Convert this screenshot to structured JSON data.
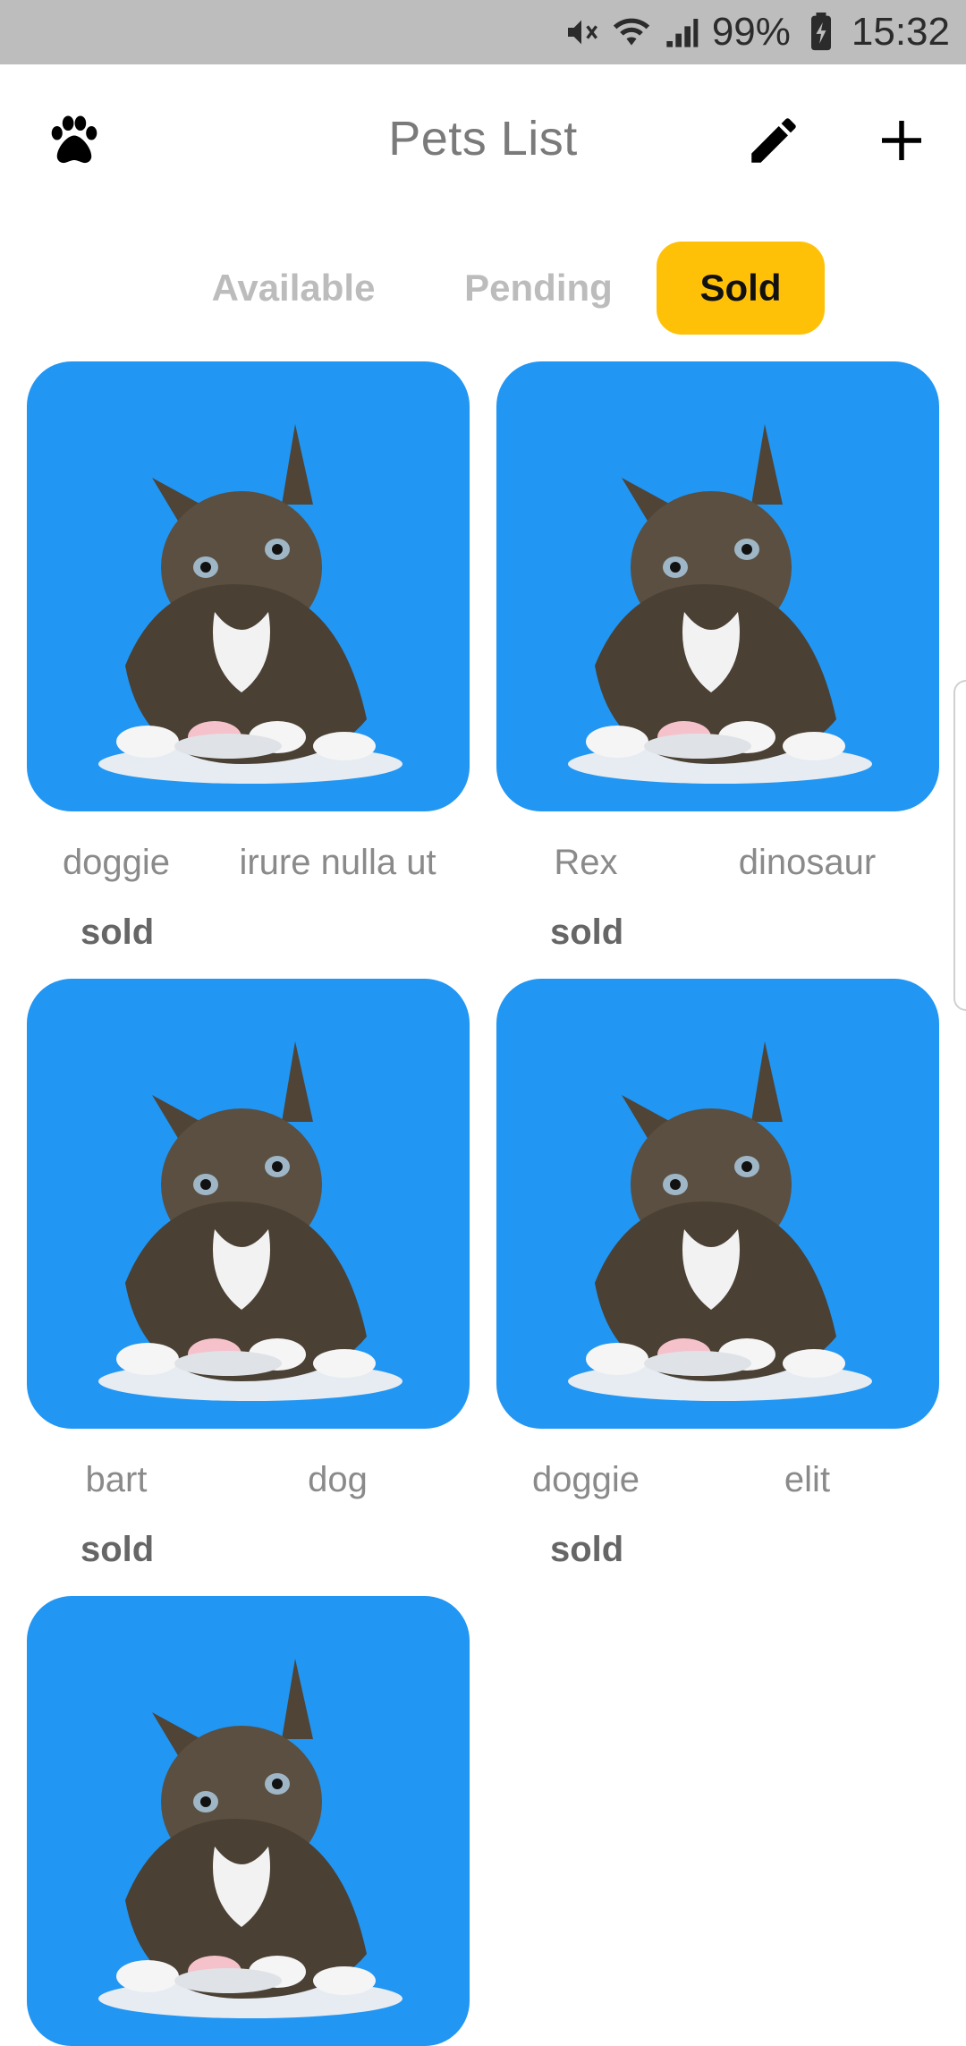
{
  "status_bar": {
    "battery_percent": "99%",
    "time": "15:32",
    "icons": [
      "mute-icon",
      "wifi-icon",
      "signal-icon",
      "battery-charging-icon"
    ]
  },
  "app_bar": {
    "title": "Pets List",
    "icons": [
      "paw-icon",
      "edit-icon",
      "add-icon"
    ]
  },
  "tabs": [
    {
      "label": "Available",
      "selected": false
    },
    {
      "label": "Pending",
      "selected": false
    },
    {
      "label": "Sold",
      "selected": true
    }
  ],
  "colors": {
    "accent": "#ffc107",
    "card_background": "#2196f3",
    "status_bar": "#bdbdbd"
  },
  "pets": [
    {
      "name": "doggie",
      "category": "irure nulla ut",
      "status": "sold"
    },
    {
      "name": "Rex",
      "category": "dinosaur",
      "status": "sold"
    },
    {
      "name": "bart",
      "category": "dog",
      "status": "sold"
    },
    {
      "name": "doggie",
      "category": "elit",
      "status": "sold"
    },
    {
      "name": "",
      "category": "",
      "status": ""
    }
  ]
}
